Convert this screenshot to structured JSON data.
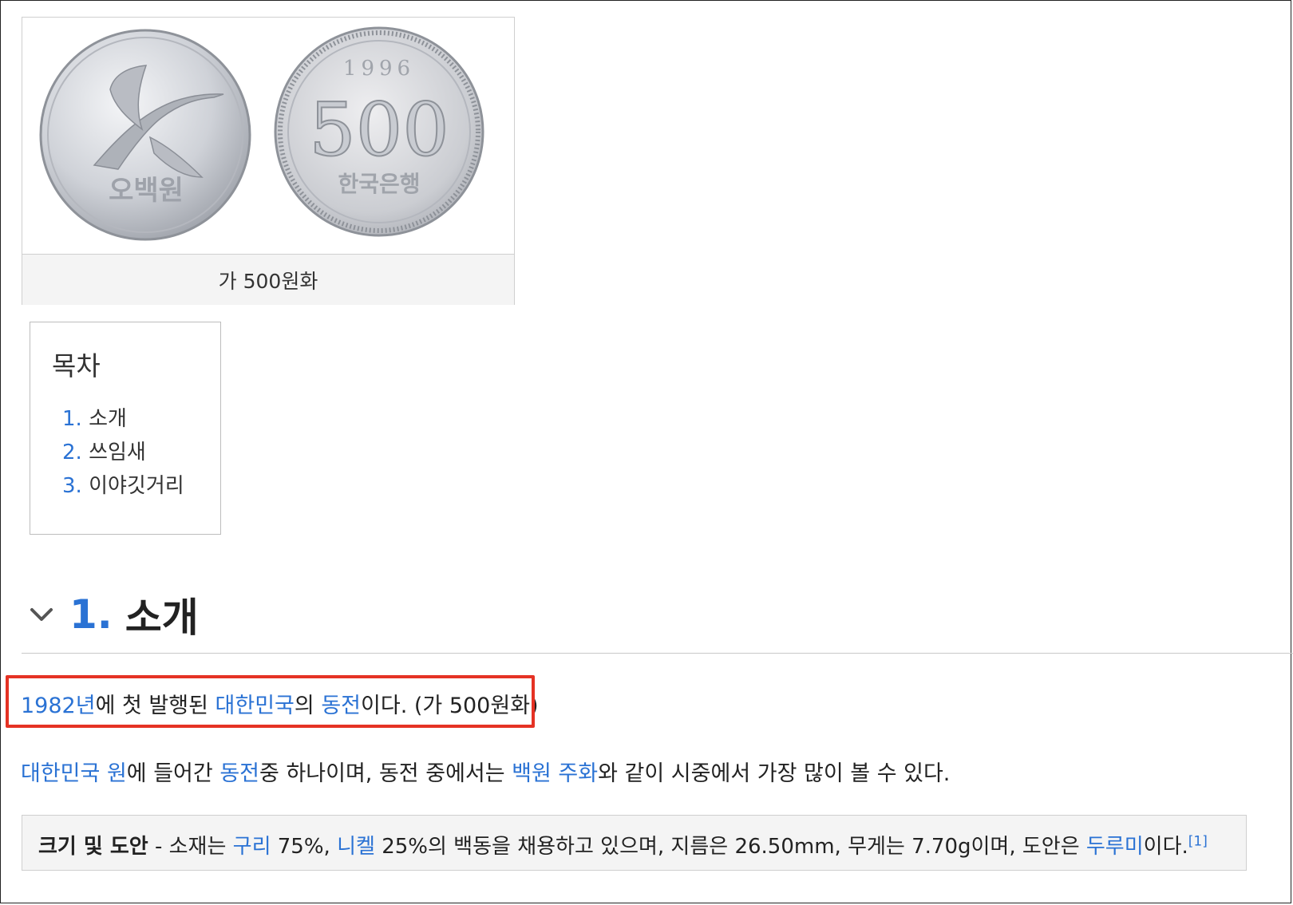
{
  "figure": {
    "coin_front_text": "오백원",
    "coin_back_year": "1996",
    "coin_back_value": "500",
    "coin_back_issuer": "한국은행",
    "caption": "가 500원화"
  },
  "toc": {
    "title": "목차",
    "items": [
      {
        "num": "1.",
        "label": "소개"
      },
      {
        "num": "2.",
        "label": "쓰임새"
      },
      {
        "num": "3.",
        "label": "이야깃거리"
      }
    ]
  },
  "section": {
    "num": "1.",
    "title": "소개"
  },
  "paragraph1": {
    "link_year": "1982년",
    "t1": "에 첫 발행된 ",
    "link_country": "대한민국",
    "t2": "의 ",
    "link_coin": "동전",
    "t3": "이다. (가 500원화)"
  },
  "paragraph2": {
    "link_won": "대한민국 원",
    "t1": "에 들어간 ",
    "link_coin": "동전",
    "t2": "중 하나이며, 동전 중에서는 ",
    "link_100": "백원 주화",
    "t3": "와 같이 시중에서 가장 많이 볼 수 있다."
  },
  "infobox": {
    "label": "크기 및 도안",
    "t0": " - 소재는 ",
    "link_copper": "구리",
    "t1": " 75%, ",
    "link_nickel": "니켈",
    "t2": " 25%의 백동을 채용하고 있으며, 지름은 26.50mm, 무게는 7.70g이며, 도안은 ",
    "link_crane": "두루미",
    "t3": "이다.",
    "ref": "[1]"
  },
  "colors": {
    "link": "#2a72d4",
    "highlight_border": "#e53224"
  }
}
